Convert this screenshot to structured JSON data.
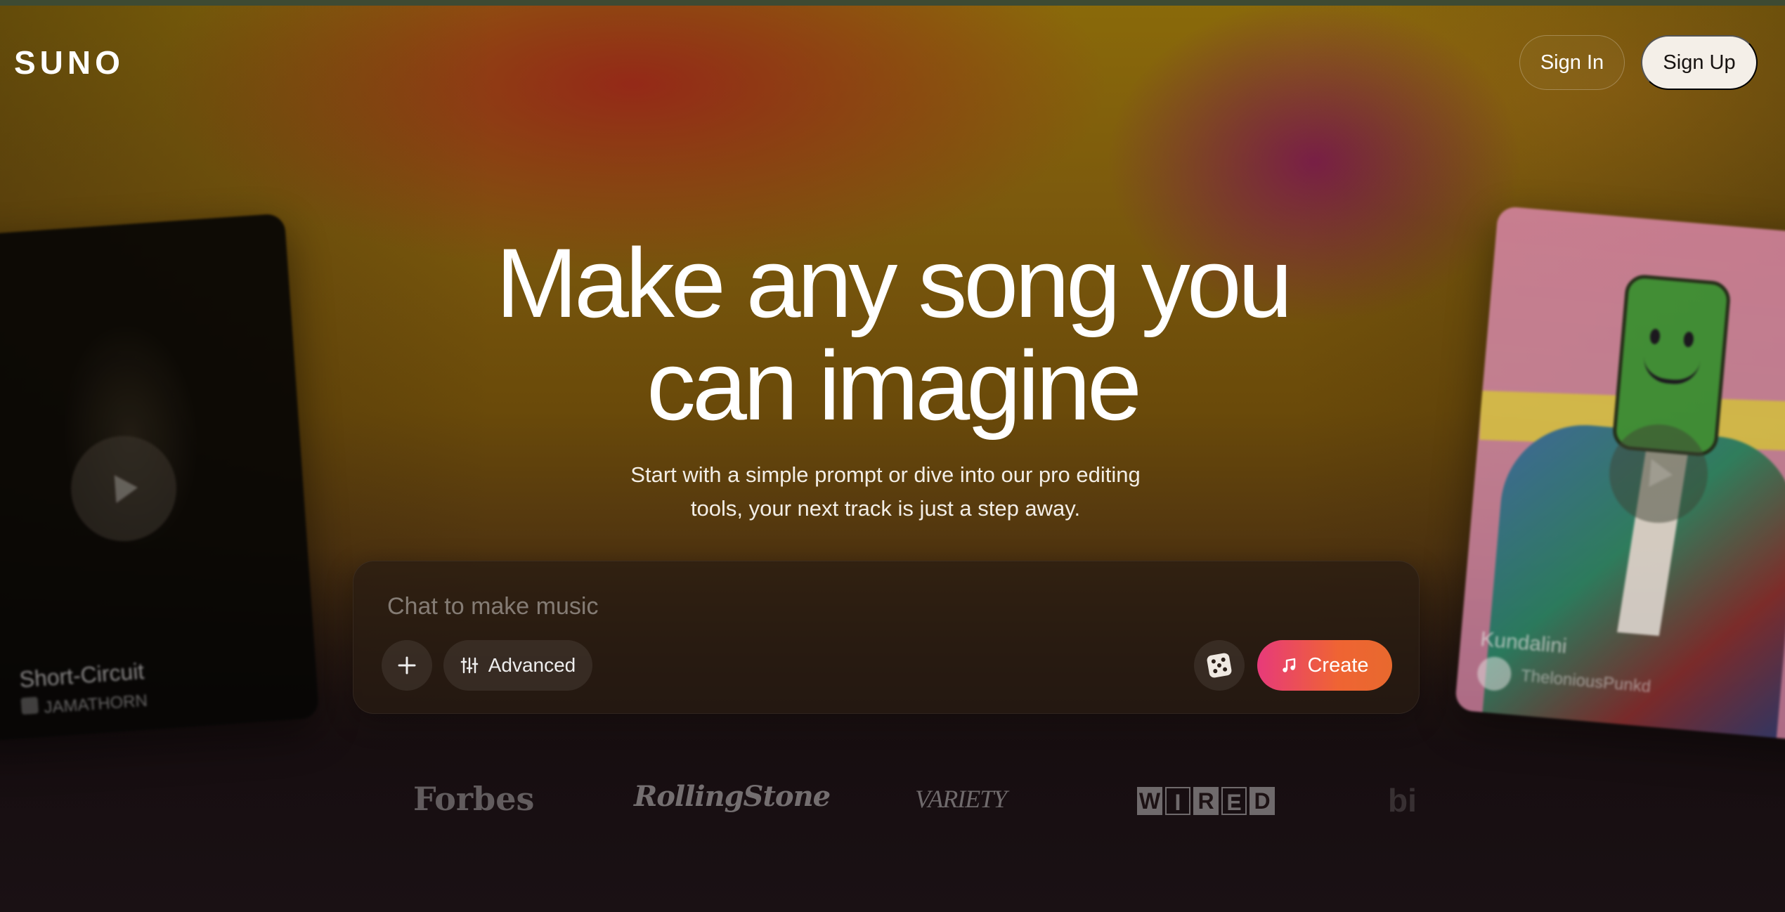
{
  "header": {
    "logo": "SUNO",
    "sign_in": "Sign In",
    "sign_up": "Sign Up"
  },
  "hero": {
    "title_line1": "Make any song you",
    "title_line2": "can imagine",
    "subtitle_line1": "Start with a simple prompt or dive into our pro editing",
    "subtitle_line2": "tools, your next track is just a step away."
  },
  "prompt": {
    "placeholder": "Chat to make music",
    "plus_icon": "plus-icon",
    "advanced_label": "Advanced",
    "advanced_icon": "sliders-icon",
    "dice_icon": "dice-icon",
    "create_label": "Create",
    "create_icon": "music-note-icon"
  },
  "cards": {
    "left": {
      "title": "Short-Circuit",
      "artist": "JAMATHORN"
    },
    "right": {
      "title": "Kundalini",
      "artist": "TheloniousPunkd"
    }
  },
  "press": {
    "forbes": "Forbes",
    "rolling_stone": "RollingStone",
    "variety": "VARIETY",
    "wired": [
      "W",
      "I",
      "R",
      "E",
      "D"
    ],
    "billboard_partial": "bi"
  },
  "colors": {
    "create_gradient_start": "#e73a7a",
    "create_gradient_end": "#e8692e",
    "sign_up_bg": "#f4efe8"
  }
}
